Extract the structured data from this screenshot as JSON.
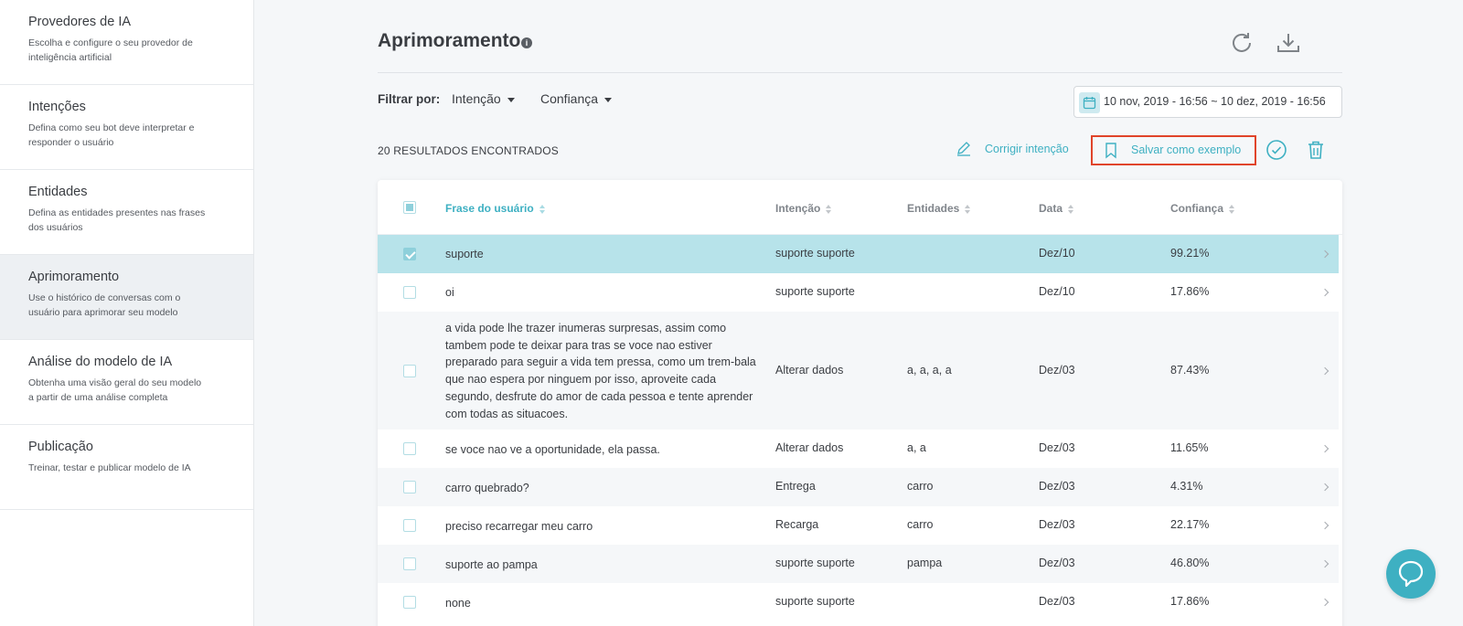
{
  "sidebar": {
    "items": [
      {
        "title": "Provedores de IA",
        "desc": "Escolha e configure o seu provedor de inteligência artificial"
      },
      {
        "title": "Intenções",
        "desc": "Defina como seu bot deve interpretar e responder o usuário"
      },
      {
        "title": "Entidades",
        "desc": "Defina as entidades presentes nas frases dos usuários"
      },
      {
        "title": "Aprimoramento",
        "desc": "Use o histórico de conversas com o usuário para aprimorar seu modelo"
      },
      {
        "title": "Análise do modelo de IA",
        "desc": "Obtenha uma visão geral do seu modelo a partir de uma análise completa"
      },
      {
        "title": "Publicação",
        "desc": "Treinar, testar e publicar modelo de IA"
      }
    ]
  },
  "header": {
    "title": "Aprimoramento",
    "info": "i"
  },
  "filters": {
    "label": "Filtrar por:",
    "intent": "Intenção",
    "confidence": "Confiança",
    "date_range": "10 nov, 2019 - 16:56 ~  10 dez, 2019 - 16:56"
  },
  "actions": {
    "results": "20 RESULTADOS ENCONTRADOS",
    "fix_intent": "Corrigir intenção",
    "save_example": "Salvar como exemplo"
  },
  "table": {
    "headers": {
      "phrase": "Frase do usuário",
      "intent": "Intenção",
      "entities": "Entidades",
      "date": "Data",
      "confidence": "Confiança"
    },
    "rows": [
      {
        "phrase": "suporte",
        "intent": "suporte suporte",
        "entities": "",
        "date": "Dez/10",
        "confidence": "99.21%"
      },
      {
        "phrase": "oi",
        "intent": "suporte suporte",
        "entities": "",
        "date": "Dez/10",
        "confidence": "17.86%"
      },
      {
        "phrase": "a vida pode lhe trazer inumeras surpresas, assim como tambem pode te deixar para tras se voce nao estiver preparado para seguir a vida tem pressa, como um trem-bala que nao espera por ninguem por isso, aproveite cada segundo, desfrute do amor de cada pessoa e tente aprender com todas as situacoes.",
        "intent": "Alterar dados",
        "entities": "a, a, a, a",
        "date": "Dez/03",
        "confidence": "87.43%"
      },
      {
        "phrase": "se voce nao ve a oportunidade, ela passa.",
        "intent": "Alterar dados",
        "entities": "a, a",
        "date": "Dez/03",
        "confidence": "11.65%"
      },
      {
        "phrase": "carro quebrado?",
        "intent": "Entrega",
        "entities": "carro",
        "date": "Dez/03",
        "confidence": "4.31%"
      },
      {
        "phrase": "preciso recarregar meu carro",
        "intent": "Recarga",
        "entities": "carro",
        "date": "Dez/03",
        "confidence": "22.17%"
      },
      {
        "phrase": "suporte ao pampa",
        "intent": "suporte suporte",
        "entities": "pampa",
        "date": "Dez/03",
        "confidence": "46.80%"
      },
      {
        "phrase": "none",
        "intent": "suporte suporte",
        "entities": "",
        "date": "Dez/03",
        "confidence": "17.86%"
      }
    ]
  },
  "colors": {
    "accent": "#3eb0c2",
    "selected_row": "#b7e3ea",
    "highlight_border": "#e0442a"
  },
  "icons": [
    "info-icon",
    "refresh-icon",
    "download-icon",
    "calendar-icon",
    "pencil-icon",
    "bookmark-icon",
    "check-circle-icon",
    "trash-icon",
    "chevron-right-icon",
    "chat-bubble-icon"
  ]
}
